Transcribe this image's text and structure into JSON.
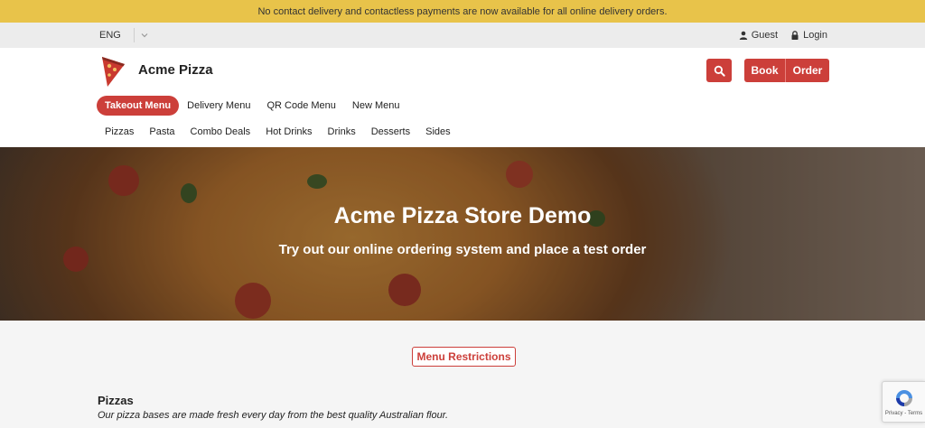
{
  "announcement": "No contact delivery and contactless payments are now available for all online delivery orders.",
  "topbar": {
    "language": "ENG",
    "guest_label": "Guest",
    "login_label": "Login"
  },
  "header": {
    "brand_name": "Acme Pizza",
    "book_label": "Book",
    "order_label": "Order"
  },
  "menu_tabs": [
    "Takeout Menu",
    "Delivery Menu",
    "QR Code Menu",
    "New Menu"
  ],
  "active_tab": "Takeout Menu",
  "categories": [
    "Pizzas",
    "Pasta",
    "Combo Deals",
    "Hot Drinks",
    "Drinks",
    "Desserts",
    "Sides"
  ],
  "hero": {
    "title": "Acme Pizza Store Demo",
    "subtitle": "Try out our online ordering system and place a test order"
  },
  "menu_restrictions_label": "Menu Restrictions",
  "section": {
    "title": "Pizzas",
    "description": "Our pizza bases are made fresh every day from the best quality Australian flour."
  },
  "recaptcha": {
    "text": "Privacy - Terms"
  },
  "colors": {
    "accent": "#cc3f3a",
    "announcement_bg": "#e8c34a",
    "topbar_bg": "#ececec"
  }
}
